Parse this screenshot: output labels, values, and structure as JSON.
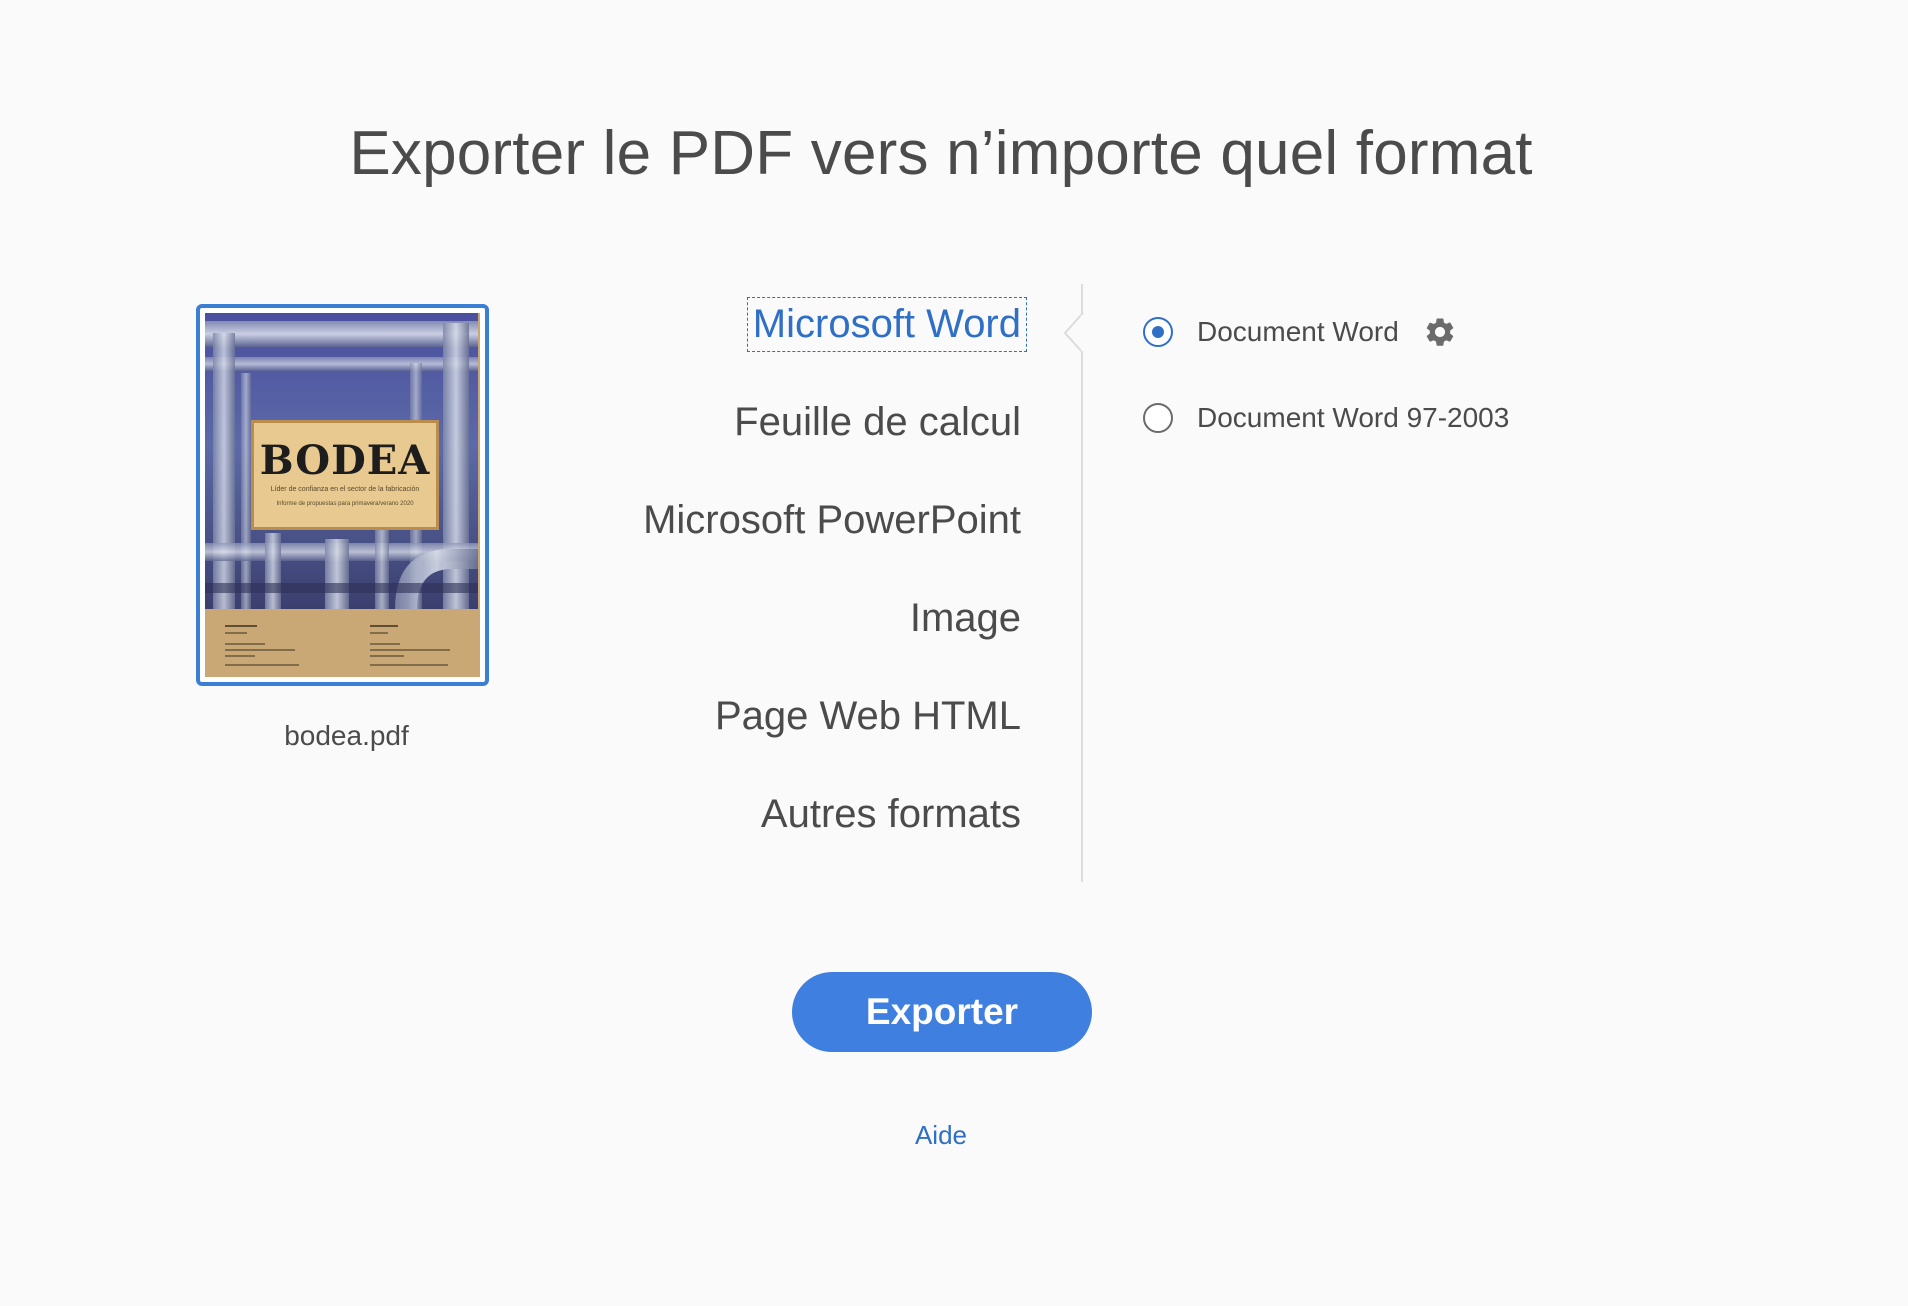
{
  "page": {
    "title": "Exporter le PDF vers n’importe quel format"
  },
  "file": {
    "name": "bodea.pdf",
    "cover_title": "BODEA",
    "cover_subtitle": "Líder de confianza en el sector de la fabricación",
    "cover_subtitle2": "Informe de propuestas para primavera/verano 2020"
  },
  "formats": [
    {
      "label": "Microsoft Word",
      "selected": true
    },
    {
      "label": "Feuille de calcul",
      "selected": false
    },
    {
      "label": "Microsoft PowerPoint",
      "selected": false
    },
    {
      "label": "Image",
      "selected": false
    },
    {
      "label": "Page Web HTML",
      "selected": false
    },
    {
      "label": "Autres formats",
      "selected": false
    }
  ],
  "options": [
    {
      "label": "Document Word",
      "checked": true,
      "icon": "gear-icon"
    },
    {
      "label": "Document Word 97-2003",
      "checked": false
    }
  ],
  "actions": {
    "export_label": "Exporter",
    "help_label": "Aide"
  },
  "colors": {
    "accent": "#3e7fe0",
    "link": "#2f6fc6",
    "text": "#4b4b4b",
    "background": "#fafafa"
  }
}
